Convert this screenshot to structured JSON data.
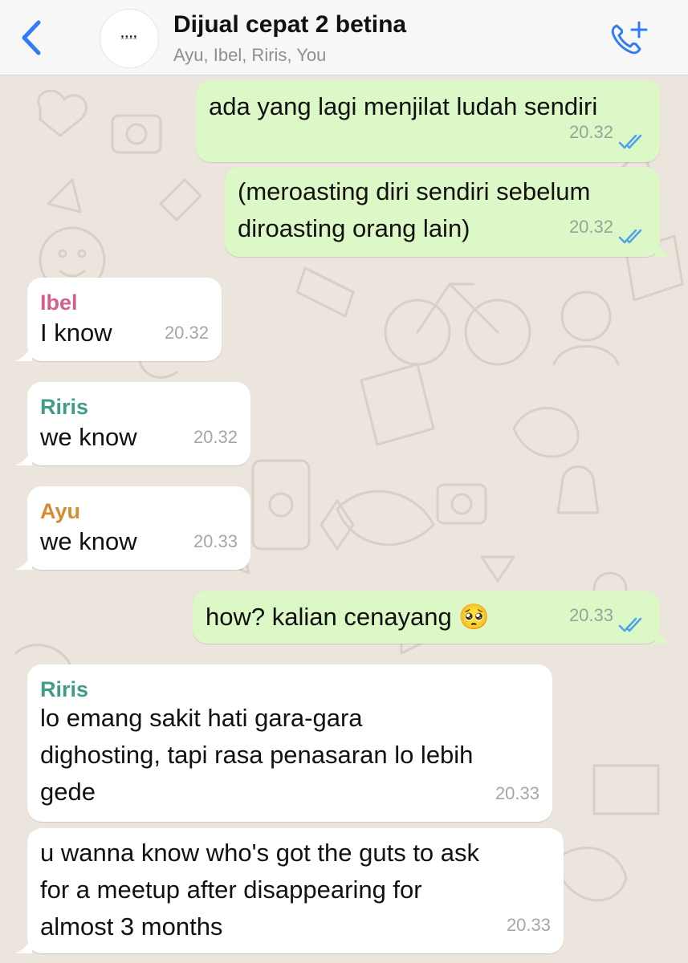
{
  "header": {
    "title": "Dijual cepat 2 betina",
    "members": "Ayu, Ibel, Riris, You",
    "avatar_text": "ᵜᵜᵜᵜ"
  },
  "colors": {
    "accent": "#2f7cf6",
    "outgoing_bubble": "#dcf8c6",
    "incoming_bubble": "#ffffff",
    "read_ticks": "#4fa3e8",
    "sender_ibel": "#d1618a",
    "sender_riris": "#3f9b8a",
    "sender_ayu": "#d98a2f"
  },
  "messages": [
    {
      "direction": "outgoing",
      "text": "ada yang lagi menjilat ludah sendiri",
      "time": "20.32",
      "status": "read"
    },
    {
      "direction": "outgoing",
      "text": "(meroasting diri sendiri sebelum\ndiroasting orang lain)",
      "time": "20.32",
      "status": "read"
    },
    {
      "direction": "incoming",
      "sender": "Ibel",
      "text": "I know",
      "time": "20.32"
    },
    {
      "direction": "incoming",
      "sender": "Riris",
      "text": "we know",
      "time": "20.32"
    },
    {
      "direction": "incoming",
      "sender": "Ayu",
      "text": "we know",
      "time": "20.33"
    },
    {
      "direction": "outgoing",
      "text": "how? kalian cenayang 🥺",
      "time": "20.33",
      "status": "read"
    },
    {
      "direction": "incoming",
      "sender": "Riris",
      "text": "lo emang sakit hati gara-gara\ndighosting, tapi rasa penasaran lo lebih\ngede",
      "time": "20.33"
    },
    {
      "direction": "incoming",
      "text": "u wanna know who's got the guts to ask\nfor a meetup after disappearing for\nalmost 3 months",
      "time": "20.33"
    }
  ]
}
